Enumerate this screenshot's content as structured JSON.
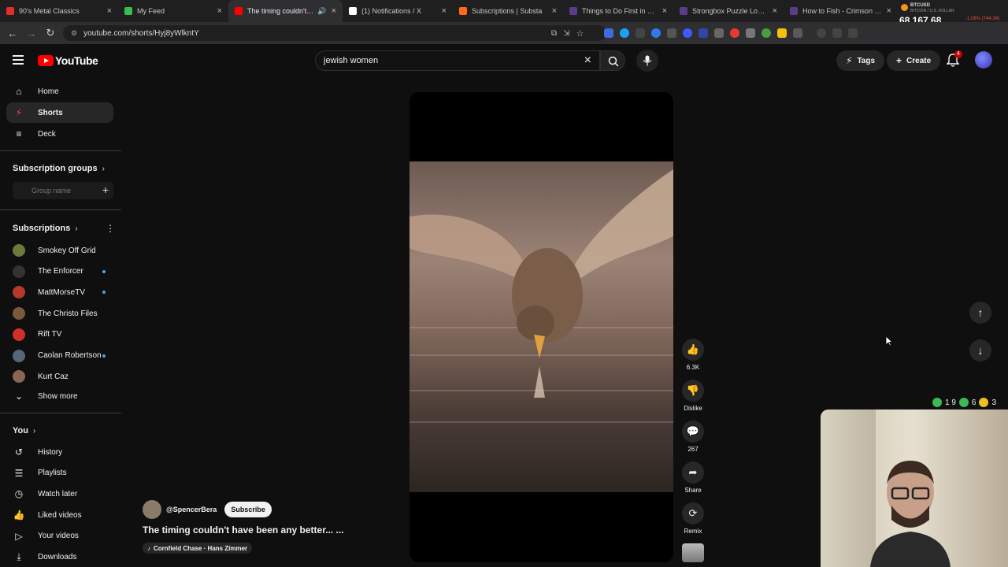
{
  "browser": {
    "tabs": [
      {
        "title": "90's Metal Classics",
        "color": "#e52d27",
        "active": false
      },
      {
        "title": "My Feed",
        "color": "#3cba54",
        "active": false
      },
      {
        "title": "The timing couldn't ha",
        "color": "#ff0000",
        "active": true
      },
      {
        "title": "(1) Notifications / X",
        "color": "#ffffff",
        "active": false
      },
      {
        "title": "Subscriptions | Substa",
        "color": "#ff6719",
        "active": false
      },
      {
        "title": "Things to Do First in Crim",
        "color": "#5a3d8a",
        "active": false
      },
      {
        "title": "Strongbox Puzzle Location",
        "color": "#5a3d8a",
        "active": false
      },
      {
        "title": "How to Fish - Crimson De",
        "color": "#5a3d8a",
        "active": false
      }
    ],
    "url": "youtube.com/shorts/Hyj8yWlkntY",
    "ticker": {
      "symbol": "BTCUSD",
      "description": "BITCOIN / U.S. DOLLAR",
      "price": "68,167.68",
      "change": "-1.08% (744.34)"
    }
  },
  "header": {
    "logo_text": "YouTube",
    "search_value": "jewish women",
    "tags_label": "Tags",
    "create_label": "Create",
    "notification_count": "4"
  },
  "sidebar": {
    "main": [
      {
        "label": "Home",
        "icon": "home-icon",
        "glyph": "⌂"
      },
      {
        "label": "Shorts",
        "icon": "shorts-icon",
        "glyph": "⚡"
      },
      {
        "label": "Deck",
        "icon": "deck-icon",
        "glyph": "≡"
      }
    ],
    "subscription_groups_label": "Subscription groups",
    "group_name_placeholder": "Group name",
    "subscriptions_label": "Subscriptions",
    "subscriptions": [
      {
        "name": "Smokey Off Grid",
        "color": "#6b7a3a",
        "new": false
      },
      {
        "name": "The Enforcer",
        "color": "#333333",
        "new": true
      },
      {
        "name": "MattMorseTV",
        "color": "#b33a2a",
        "new": true
      },
      {
        "name": "The Christo Files",
        "color": "#7a5a3a",
        "new": false
      },
      {
        "name": "Rift TV",
        "color": "#d0302a",
        "new": false
      },
      {
        "name": "Caolan Robertson",
        "color": "#556677",
        "new": true
      },
      {
        "name": "Kurt Caz",
        "color": "#886655",
        "new": false
      }
    ],
    "show_more_label": "Show more",
    "you_label": "You",
    "you_items": [
      {
        "label": "History",
        "icon": "history-icon",
        "glyph": "↺"
      },
      {
        "label": "Playlists",
        "icon": "playlists-icon",
        "glyph": "☰"
      },
      {
        "label": "Watch later",
        "icon": "watch-later-icon",
        "glyph": "◷"
      },
      {
        "label": "Liked videos",
        "icon": "like-icon",
        "glyph": "👍"
      },
      {
        "label": "Your videos",
        "icon": "your-videos-icon",
        "glyph": "▷"
      },
      {
        "label": "Downloads",
        "icon": "download-icon",
        "glyph": "⤓"
      }
    ]
  },
  "short": {
    "channel": "@SpencerBera",
    "subscribe_label": "Subscribe",
    "title": "The timing couldn't have been any better... ...",
    "music": "Cornfield Chase · Hans Zimmer",
    "actions": [
      {
        "name": "like-button",
        "glyph": "👍",
        "label": "6.3K"
      },
      {
        "name": "dislike-button",
        "glyph": "👎",
        "label": "Dislike"
      },
      {
        "name": "comments-button",
        "glyph": "💬",
        "label": "267"
      },
      {
        "name": "share-button",
        "glyph": "➦",
        "label": "Share"
      },
      {
        "name": "remix-button",
        "glyph": "⟳",
        "label": "Remix"
      }
    ]
  },
  "overlay": {
    "counters": [
      {
        "color": "#3cba54",
        "value": "1 9"
      },
      {
        "color": "#3cba54",
        "value": "6"
      },
      {
        "color": "#f0c020",
        "value": "3"
      }
    ]
  }
}
